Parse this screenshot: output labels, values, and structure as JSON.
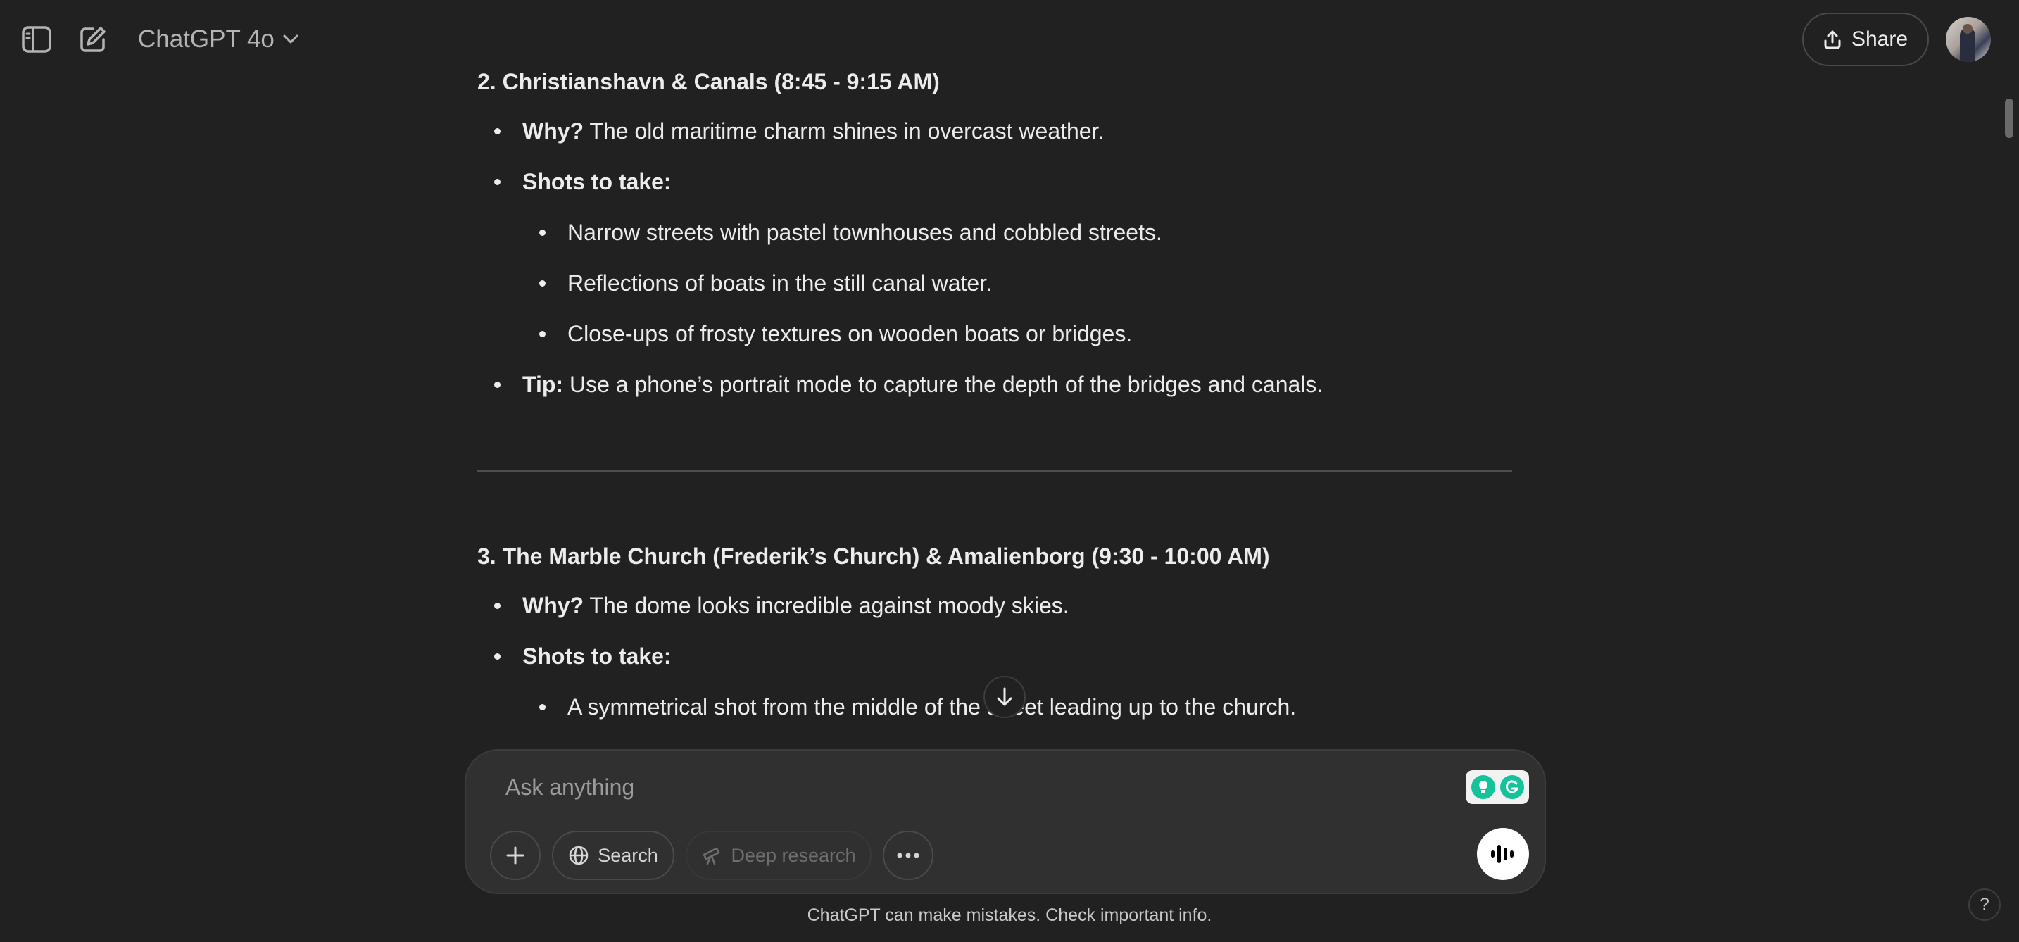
{
  "header": {
    "model_name": "ChatGPT 4o",
    "share_label": "Share"
  },
  "sections": [
    {
      "title": "2. Christianshavn & Canals (8:45 - 9:15 AM)",
      "why_label": "Why?",
      "why_text": " The old maritime charm shines in overcast weather.",
      "shots_label": "Shots to take:",
      "shots": [
        "Narrow streets with pastel townhouses and cobbled streets.",
        "Reflections of boats in the still canal water.",
        "Close-ups of frosty textures on wooden boats or bridges."
      ],
      "tip_label": "Tip:",
      "tip_text": " Use a phone’s portrait mode to capture the depth of the bridges and canals."
    },
    {
      "title": "3. The Marble Church (Frederik’s Church) & Amalienborg (9:30 - 10:00 AM)",
      "why_label": "Why?",
      "why_text": " The dome looks incredible against moody skies.",
      "shots_label": "Shots to take:",
      "shots": [
        "A symmetrical shot from the middle of the street leading up to the church."
      ]
    }
  ],
  "composer": {
    "placeholder": "Ask anything",
    "search_label": "Search",
    "deep_research_label": "Deep research"
  },
  "footer": {
    "disclaimer": "ChatGPT can make mistakes. Check important info.",
    "help_label": "?"
  },
  "colors": {
    "background": "#212121",
    "composer": "#303030",
    "text": "#ececec",
    "grammarly": "#15c39a"
  }
}
